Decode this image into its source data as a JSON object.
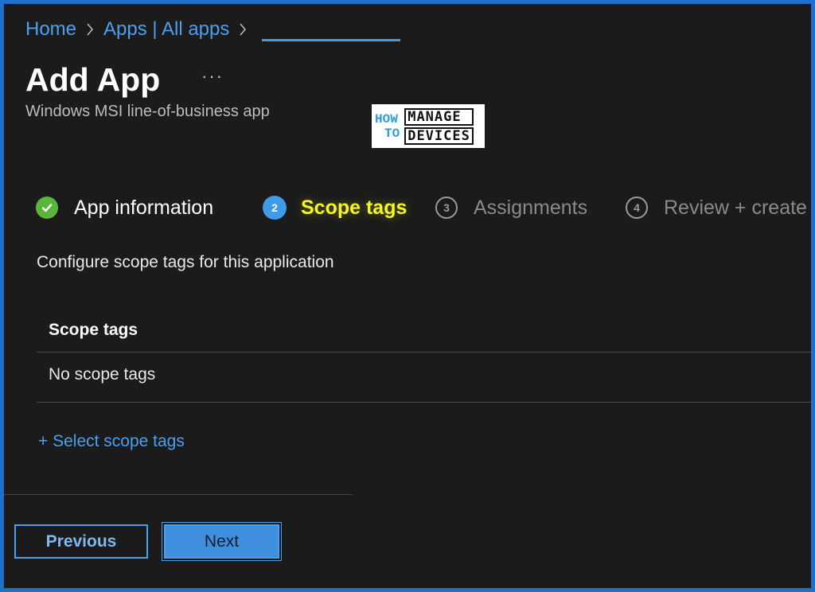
{
  "breadcrumb": {
    "items": [
      "Home",
      "Apps | All apps"
    ]
  },
  "header": {
    "title": "Add App",
    "more_label": "···",
    "subtitle": "Windows MSI line-of-business app"
  },
  "logo": {
    "left_top": "HOW",
    "left_bottom": "TO",
    "right_top": "MANAGE",
    "right_bottom": "DEVICES"
  },
  "steps": [
    {
      "number": "",
      "label": "App information",
      "state": "done"
    },
    {
      "number": "2",
      "label": "Scope tags",
      "state": "active"
    },
    {
      "number": "3",
      "label": "Assignments",
      "state": "future"
    },
    {
      "number": "4",
      "label": "Review + create",
      "state": "future"
    }
  ],
  "content": {
    "description": "Configure scope tags for this application",
    "table_header": "Scope tags",
    "empty_text": "No scope tags",
    "select_link": "+ Select scope tags"
  },
  "footer": {
    "previous_label": "Previous",
    "next_label": "Next"
  },
  "colors": {
    "accent": "#3f9ae8",
    "link": "#4aa0f0",
    "active_step_text": "#f5f52a",
    "done_step": "#5ab53a",
    "frame_border": "#1f6fcb",
    "background": "#1b1b1b"
  }
}
